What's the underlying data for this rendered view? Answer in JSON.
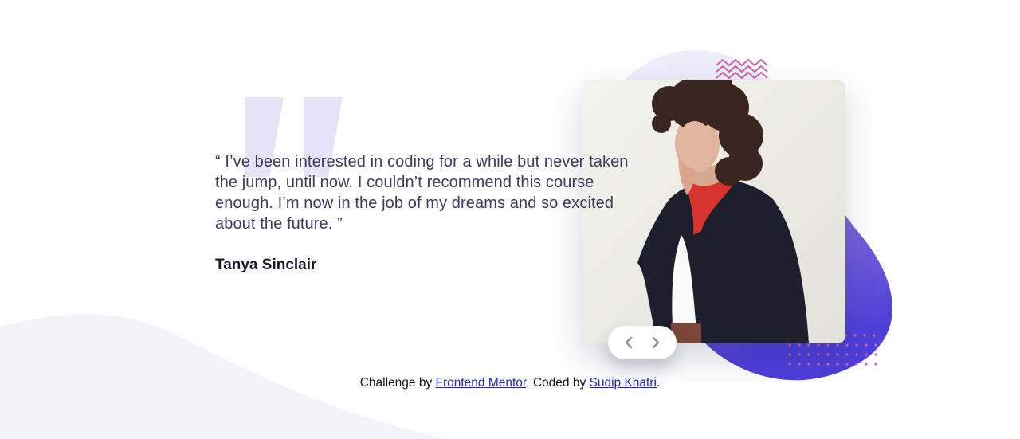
{
  "testimonial": {
    "quote": "“ I’ve been interested in coding for a while but never taken the jump, until now. I couldn’t recommend this course enough. I’m now in the job of my dreams and so excited about the future. ”",
    "author": "Tanya Sinclair"
  },
  "photo": {
    "alt": "Tanya Sinclair portrait"
  },
  "slider": {
    "prev_icon": "chevron-left-icon",
    "next_icon": "chevron-right-icon"
  },
  "footer": {
    "prefix": "Challenge by ",
    "link1": "Frontend Mentor",
    "middle": ". Coded by ",
    "link2": "Sudip Khatri",
    "suffix": "."
  },
  "colors": {
    "accent_purple": "#7a66d8",
    "accent_dark": "#4a3fd6",
    "quote_mark": "#e5e3f6",
    "pattern_pink": "#cc66aa",
    "text_dark": "#18182e",
    "curve_bg": "#f2f2fa"
  }
}
